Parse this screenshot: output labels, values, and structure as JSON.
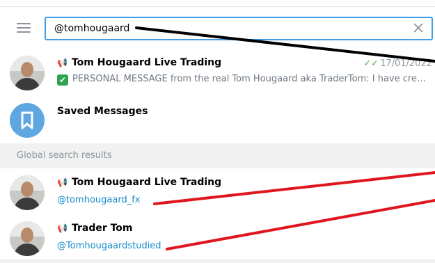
{
  "search": {
    "value": "@tomhougaard"
  },
  "chats": [
    {
      "title": "Tom Hougaard Live Trading",
      "date": "17/01/2022",
      "preview": "PERSONAL MESSAGE from the real Tom Hougaard aka TraderTom:  I have cre…"
    },
    {
      "title": "Saved Messages"
    }
  ],
  "global": {
    "label": "Global search results",
    "results": [
      {
        "title": "Tom Hougaard Live Trading",
        "handle": "@tomhougaard_fx"
      },
      {
        "title": "Trader Tom",
        "handle": "@Tomhougaardstudied"
      }
    ]
  },
  "colors": {
    "accent": "#3e9de6",
    "link": "#168acd",
    "annotation_black": "#000000",
    "annotation_red": "#e0161e"
  },
  "icons": [
    "menu-icon",
    "clear-icon",
    "megaphone-icon",
    "double-check-icon",
    "green-checkmark-icon",
    "bookmark-icon"
  ]
}
